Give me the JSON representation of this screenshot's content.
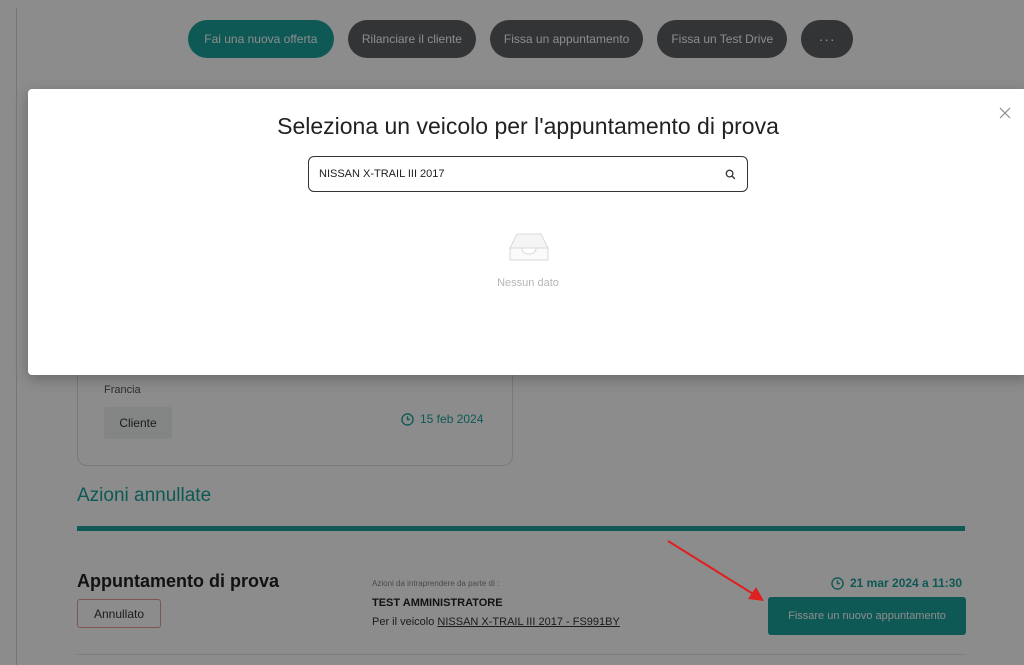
{
  "top_actions": {
    "new_offer": "Fai una nuova offerta",
    "relaunch_client": "Rilanciare il cliente",
    "set_appointment": "Fissa un appuntamento",
    "set_test_drive": "Fissa un Test Drive",
    "more": "···"
  },
  "contact_card": {
    "country": "Francia",
    "client_button": "Cliente",
    "date": "15 feb 2024"
  },
  "cancelled_section": {
    "title": "Azioni annullate"
  },
  "appointment": {
    "title": "Appuntamento di prova",
    "status": "Annullato",
    "actions_label": "Azioni da intraprendere da parte di :",
    "assignee": "TEST AMMINISTRATORE",
    "vehicle_prefix": "Per il veicolo",
    "vehicle": "NISSAN X-TRAIL III 2017 - FS991BY",
    "date": "21 mar 2024 a 11:30",
    "new_appointment_button": "Fissare un nuovo appuntamento"
  },
  "modal": {
    "title": "Seleziona un veicolo per l'appuntamento di prova",
    "search_value": "NISSAN X-TRAIL III 2017",
    "empty_text": "Nessun dato",
    "close": "×"
  },
  "colors": {
    "accent": "#1ba39c",
    "dark_button": "#5b5f63",
    "annotation": "#e02020"
  },
  "icons": [
    "clock-icon",
    "search-icon",
    "empty-inbox-icon",
    "close-icon"
  ]
}
